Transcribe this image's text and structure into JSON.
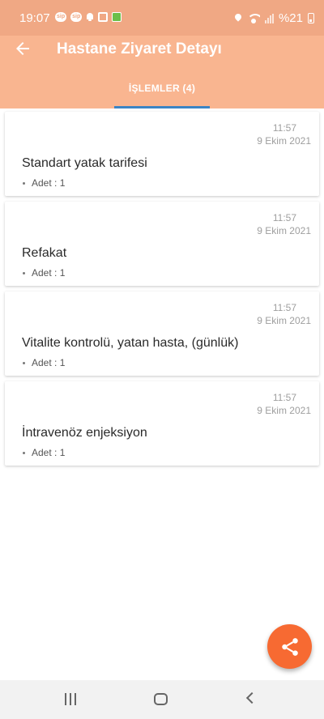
{
  "status_bar": {
    "time": "19:07",
    "notification_icons": [
      "sip",
      "sip"
    ],
    "battery_text": "%21"
  },
  "header": {
    "title": "Hastane Ziyaret Detayı",
    "back_icon": "arrow-left-icon"
  },
  "tabs": [
    {
      "label": "İŞLEMLER (4)",
      "active": true
    }
  ],
  "procedures": [
    {
      "time": "11:57",
      "date": "9 Ekim 2021",
      "name": "Standart yatak tarifesi",
      "detail": "Adet : 1"
    },
    {
      "time": "11:57",
      "date": "9 Ekim 2021",
      "name": "Refakat",
      "detail": "Adet : 1"
    },
    {
      "time": "11:57",
      "date": "9 Ekim 2021",
      "name": "Vitalite kontrolü, yatan hasta, (günlük)",
      "detail": "Adet : 1"
    },
    {
      "time": "11:57",
      "date": "9 Ekim 2021",
      "name": "İntravenöz enjeksiyon",
      "detail": "Adet : 1"
    }
  ],
  "fab": {
    "icon": "share-icon"
  },
  "colors": {
    "status_bar": "#f0a884",
    "app_bar": "#f9b590",
    "tab_indicator": "#3b84c4",
    "fab": "#f76a32"
  }
}
